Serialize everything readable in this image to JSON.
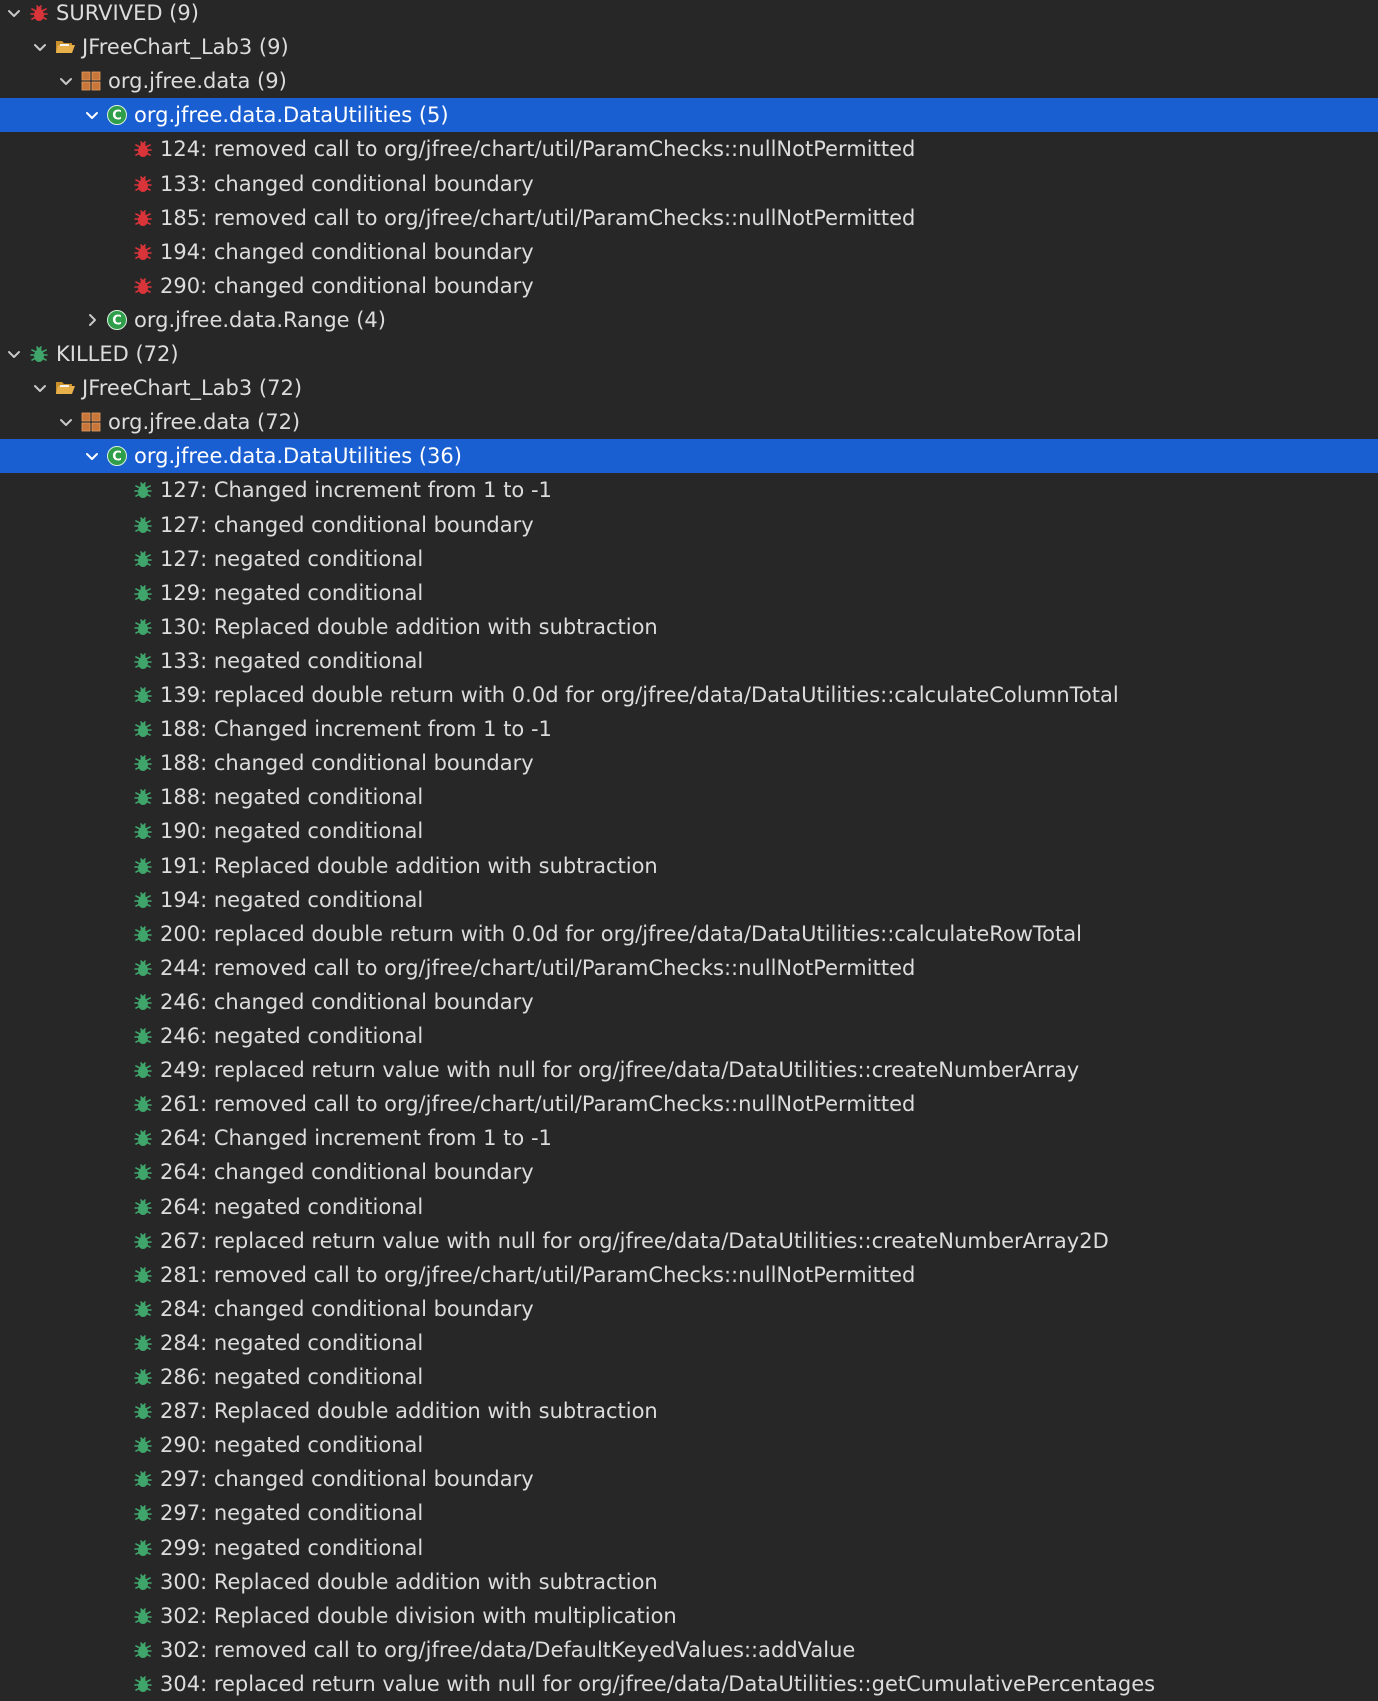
{
  "tree": [
    {
      "text": "SURVIVED (9)",
      "depth": 0,
      "kind": "survived-category",
      "expanded": true
    },
    {
      "text": "JFreeChart_Lab3 (9)",
      "depth": 1,
      "kind": "project",
      "expanded": true
    },
    {
      "text": "org.jfree.data (9)",
      "depth": 2,
      "kind": "package",
      "expanded": true
    },
    {
      "text": "org.jfree.data.DataUtilities (5)",
      "depth": 3,
      "kind": "class",
      "expanded": true,
      "selected": true
    },
    {
      "text": "124: removed call to org/jfree/chart/util/ParamChecks::nullNotPermitted",
      "depth": 4,
      "kind": "survived-mutation"
    },
    {
      "text": "133: changed conditional boundary",
      "depth": 4,
      "kind": "survived-mutation"
    },
    {
      "text": "185: removed call to org/jfree/chart/util/ParamChecks::nullNotPermitted",
      "depth": 4,
      "kind": "survived-mutation"
    },
    {
      "text": "194: changed conditional boundary",
      "depth": 4,
      "kind": "survived-mutation"
    },
    {
      "text": "290: changed conditional boundary",
      "depth": 4,
      "kind": "survived-mutation"
    },
    {
      "text": "org.jfree.data.Range (4)",
      "depth": 3,
      "kind": "class",
      "expanded": false
    },
    {
      "text": "KILLED (72)",
      "depth": 0,
      "kind": "killed-category",
      "expanded": true
    },
    {
      "text": "JFreeChart_Lab3 (72)",
      "depth": 1,
      "kind": "project",
      "expanded": true
    },
    {
      "text": "org.jfree.data (72)",
      "depth": 2,
      "kind": "package",
      "expanded": true
    },
    {
      "text": "org.jfree.data.DataUtilities (36)",
      "depth": 3,
      "kind": "class",
      "expanded": true,
      "selected": true
    },
    {
      "text": "127: Changed increment from 1 to -1",
      "depth": 4,
      "kind": "killed-mutation"
    },
    {
      "text": "127: changed conditional boundary",
      "depth": 4,
      "kind": "killed-mutation"
    },
    {
      "text": "127: negated conditional",
      "depth": 4,
      "kind": "killed-mutation"
    },
    {
      "text": "129: negated conditional",
      "depth": 4,
      "kind": "killed-mutation"
    },
    {
      "text": "130: Replaced double addition with subtraction",
      "depth": 4,
      "kind": "killed-mutation"
    },
    {
      "text": "133: negated conditional",
      "depth": 4,
      "kind": "killed-mutation"
    },
    {
      "text": "139: replaced double return with 0.0d for org/jfree/data/DataUtilities::calculateColumnTotal",
      "depth": 4,
      "kind": "killed-mutation"
    },
    {
      "text": "188: Changed increment from 1 to -1",
      "depth": 4,
      "kind": "killed-mutation"
    },
    {
      "text": "188: changed conditional boundary",
      "depth": 4,
      "kind": "killed-mutation"
    },
    {
      "text": "188: negated conditional",
      "depth": 4,
      "kind": "killed-mutation"
    },
    {
      "text": "190: negated conditional",
      "depth": 4,
      "kind": "killed-mutation"
    },
    {
      "text": "191: Replaced double addition with subtraction",
      "depth": 4,
      "kind": "killed-mutation"
    },
    {
      "text": "194: negated conditional",
      "depth": 4,
      "kind": "killed-mutation"
    },
    {
      "text": "200: replaced double return with 0.0d for org/jfree/data/DataUtilities::calculateRowTotal",
      "depth": 4,
      "kind": "killed-mutation"
    },
    {
      "text": "244: removed call to org/jfree/chart/util/ParamChecks::nullNotPermitted",
      "depth": 4,
      "kind": "killed-mutation"
    },
    {
      "text": "246: changed conditional boundary",
      "depth": 4,
      "kind": "killed-mutation"
    },
    {
      "text": "246: negated conditional",
      "depth": 4,
      "kind": "killed-mutation"
    },
    {
      "text": "249: replaced return value with null for org/jfree/data/DataUtilities::createNumberArray",
      "depth": 4,
      "kind": "killed-mutation"
    },
    {
      "text": "261: removed call to org/jfree/chart/util/ParamChecks::nullNotPermitted",
      "depth": 4,
      "kind": "killed-mutation"
    },
    {
      "text": "264: Changed increment from 1 to -1",
      "depth": 4,
      "kind": "killed-mutation"
    },
    {
      "text": "264: changed conditional boundary",
      "depth": 4,
      "kind": "killed-mutation"
    },
    {
      "text": "264: negated conditional",
      "depth": 4,
      "kind": "killed-mutation"
    },
    {
      "text": "267: replaced return value with null for org/jfree/data/DataUtilities::createNumberArray2D",
      "depth": 4,
      "kind": "killed-mutation"
    },
    {
      "text": "281: removed call to org/jfree/chart/util/ParamChecks::nullNotPermitted",
      "depth": 4,
      "kind": "killed-mutation"
    },
    {
      "text": "284: changed conditional boundary",
      "depth": 4,
      "kind": "killed-mutation"
    },
    {
      "text": "284: negated conditional",
      "depth": 4,
      "kind": "killed-mutation"
    },
    {
      "text": "286: negated conditional",
      "depth": 4,
      "kind": "killed-mutation"
    },
    {
      "text": "287: Replaced double addition with subtraction",
      "depth": 4,
      "kind": "killed-mutation"
    },
    {
      "text": "290: negated conditional",
      "depth": 4,
      "kind": "killed-mutation"
    },
    {
      "text": "297: changed conditional boundary",
      "depth": 4,
      "kind": "killed-mutation"
    },
    {
      "text": "297: negated conditional",
      "depth": 4,
      "kind": "killed-mutation"
    },
    {
      "text": "299: negated conditional",
      "depth": 4,
      "kind": "killed-mutation"
    },
    {
      "text": "300: Replaced double addition with subtraction",
      "depth": 4,
      "kind": "killed-mutation"
    },
    {
      "text": "302: Replaced double division with multiplication",
      "depth": 4,
      "kind": "killed-mutation"
    },
    {
      "text": "302: removed call to org/jfree/data/DefaultKeyedValues::addValue",
      "depth": 4,
      "kind": "killed-mutation"
    },
    {
      "text": "304: replaced return value with null for org/jfree/data/DataUtilities::getCumulativePercentages",
      "depth": 4,
      "kind": "killed-mutation"
    }
  ],
  "colors": {
    "background": "#272727",
    "selection": "#1a5fd1",
    "text": "#dcdcdc",
    "survived_bug": "#d9343a",
    "killed_bug": "#3fa56b",
    "class_icon": "#2f9e4a",
    "folder": "#e8b04a",
    "package": "#c8763a"
  }
}
